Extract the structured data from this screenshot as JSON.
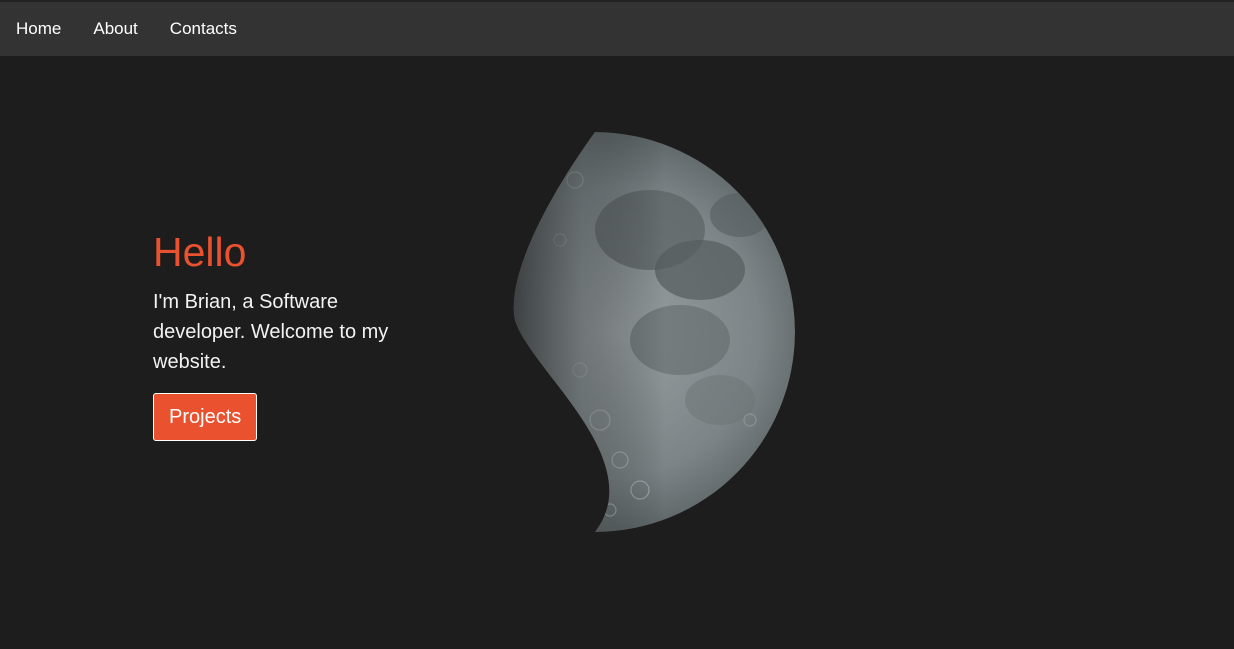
{
  "nav": {
    "items": [
      {
        "label": "Home"
      },
      {
        "label": "About"
      },
      {
        "label": "Contacts"
      }
    ]
  },
  "hero": {
    "title": "Hello",
    "intro": "I'm Brian, a Software developer. Welcome to my website.",
    "button_label": "Projects"
  },
  "colors": {
    "accent": "#e9512f",
    "background": "#1d1d1d",
    "navbar": "#333333"
  },
  "image": {
    "icon": "moon-photo"
  }
}
